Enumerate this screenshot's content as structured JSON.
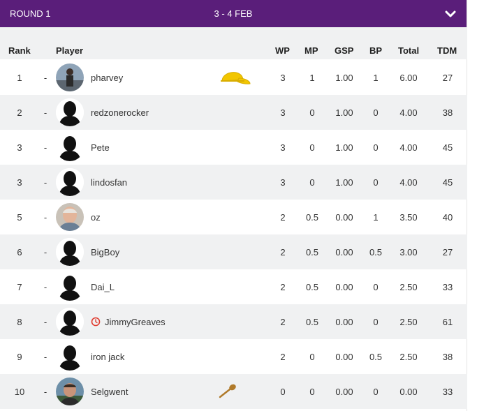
{
  "header": {
    "round_label": "ROUND 1",
    "dates": "3 - 4 FEB",
    "expand_icon": "chevron-down-icon"
  },
  "columns": {
    "rank": "Rank",
    "player": "Player",
    "wp": "WP",
    "mp": "MP",
    "gsp": "GSP",
    "bp": "BP",
    "total": "Total",
    "tdm": "TDM"
  },
  "colors": {
    "header_bg": "#5a1e7a",
    "alt_row": "#f0f1f2",
    "cap": "#f2c600",
    "clock": "#e03a2e",
    "spoon": "#b07a2a"
  },
  "rows": [
    {
      "rank": "1",
      "move": "-",
      "name": "pharvey",
      "wp": "3",
      "mp": "1",
      "gsp": "1.00",
      "bp": "1",
      "total": "6.00",
      "tdm": "27",
      "avatar": "photo",
      "badge": "cap-icon"
    },
    {
      "rank": "2",
      "move": "-",
      "name": "redzonerocker",
      "wp": "3",
      "mp": "0",
      "gsp": "1.00",
      "bp": "0",
      "total": "4.00",
      "tdm": "38",
      "avatar": "silhouette"
    },
    {
      "rank": "3",
      "move": "-",
      "name": "Pete",
      "wp": "3",
      "mp": "0",
      "gsp": "1.00",
      "bp": "0",
      "total": "4.00",
      "tdm": "45",
      "avatar": "silhouette"
    },
    {
      "rank": "3",
      "move": "-",
      "name": "lindosfan",
      "wp": "3",
      "mp": "0",
      "gsp": "1.00",
      "bp": "0",
      "total": "4.00",
      "tdm": "45",
      "avatar": "silhouette"
    },
    {
      "rank": "5",
      "move": "-",
      "name": "oz",
      "wp": "2",
      "mp": "0.5",
      "gsp": "0.00",
      "bp": "1",
      "total": "3.50",
      "tdm": "40",
      "avatar": "photo"
    },
    {
      "rank": "6",
      "move": "-",
      "name": "BigBoy",
      "wp": "2",
      "mp": "0.5",
      "gsp": "0.00",
      "bp": "0.5",
      "total": "3.00",
      "tdm": "27",
      "avatar": "silhouette"
    },
    {
      "rank": "7",
      "move": "-",
      "name": "Dai_L",
      "wp": "2",
      "mp": "0.5",
      "gsp": "0.00",
      "bp": "0",
      "total": "2.50",
      "tdm": "33",
      "avatar": "silhouette"
    },
    {
      "rank": "8",
      "move": "-",
      "name": "JimmyGreaves",
      "wp": "2",
      "mp": "0.5",
      "gsp": "0.00",
      "bp": "0",
      "total": "2.50",
      "tdm": "61",
      "avatar": "silhouette",
      "status_icon": "clock-icon"
    },
    {
      "rank": "9",
      "move": "-",
      "name": "iron jack",
      "wp": "2",
      "mp": "0",
      "gsp": "0.00",
      "bp": "0.5",
      "total": "2.50",
      "tdm": "38",
      "avatar": "silhouette"
    },
    {
      "rank": "10",
      "move": "-",
      "name": "Selgwent",
      "wp": "0",
      "mp": "0",
      "gsp": "0.00",
      "bp": "0",
      "total": "0.00",
      "tdm": "33",
      "avatar": "photo",
      "badge": "wooden-spoon-icon"
    }
  ]
}
